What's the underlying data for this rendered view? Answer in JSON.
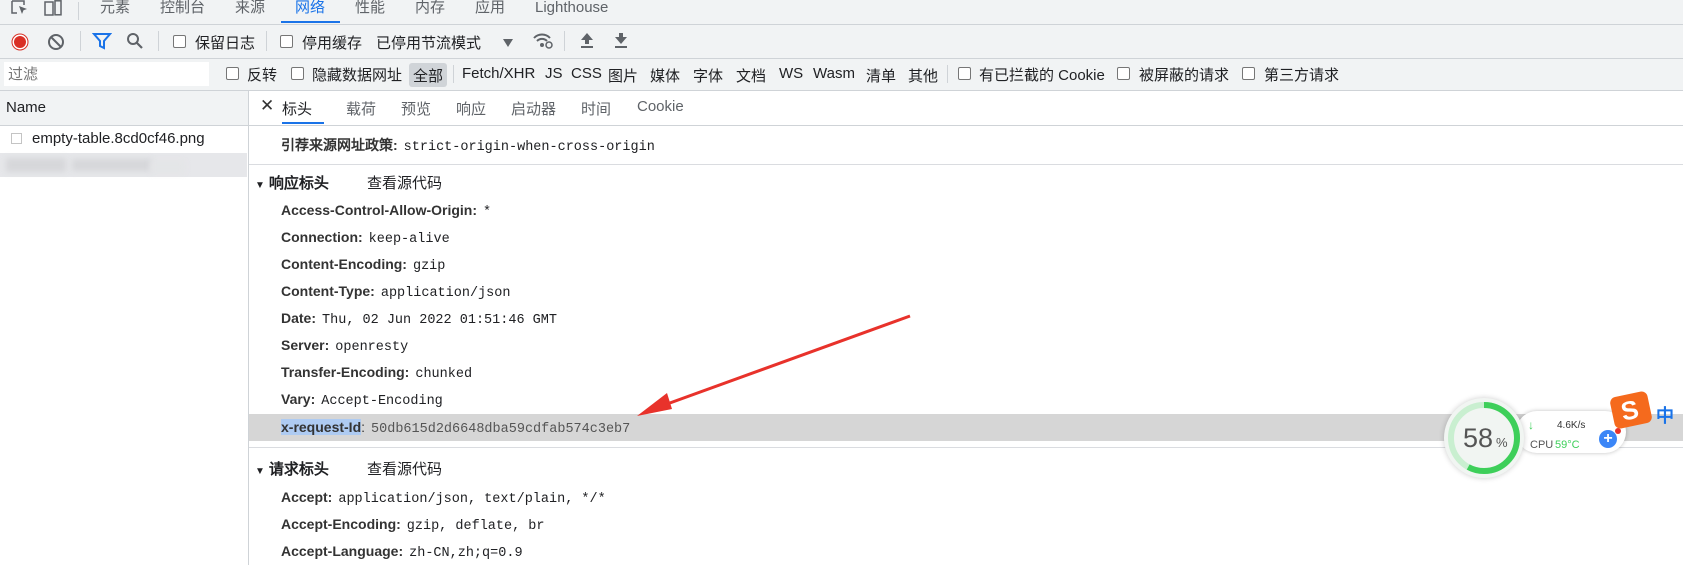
{
  "top_tabs": [
    "元素",
    "控制台",
    "来源",
    "网络",
    "性能",
    "内存",
    "应用",
    "Lighthouse"
  ],
  "active_top_tab": "网络",
  "toolbar": {
    "preserve_log": "保留日志",
    "disable_cache": "停用缓存",
    "throttle": "已停用节流模式"
  },
  "filter": {
    "placeholder": "过滤",
    "invert": "反转",
    "hide_data_urls": "隐藏数据网址",
    "types": [
      "全部",
      "Fetch/XHR",
      "JS",
      "CSS",
      "图片",
      "媒体",
      "字体",
      "文档",
      "WS",
      "Wasm",
      "清单",
      "其他"
    ],
    "blocked_cookies": "有已拦截的 Cookie",
    "blocked_requests": "被屏蔽的请求",
    "third_party": "第三方请求"
  },
  "request_list": {
    "header": "Name",
    "rows": [
      "empty-table.8cd0cf46.png"
    ]
  },
  "detail_tabs": [
    "标头",
    "载荷",
    "预览",
    "响应",
    "启动器",
    "时间",
    "Cookie"
  ],
  "referrer_policy": {
    "name": "引荐来源网址政策:",
    "value": "strict-origin-when-cross-origin"
  },
  "response_headers": {
    "title": "响应标头",
    "view_source": "查看源代码",
    "items": [
      {
        "name": "Access-Control-Allow-Origin:",
        "value": "*"
      },
      {
        "name": "Connection:",
        "value": "keep-alive"
      },
      {
        "name": "Content-Encoding:",
        "value": "gzip"
      },
      {
        "name": "Content-Type:",
        "value": "application/json"
      },
      {
        "name": "Date:",
        "value": "Thu, 02 Jun 2022 01:51:46 GMT"
      },
      {
        "name": "Server:",
        "value": "openresty"
      },
      {
        "name": "Transfer-Encoding:",
        "value": "chunked"
      },
      {
        "name": "Vary:",
        "value": "Accept-Encoding"
      },
      {
        "name": "x-request-Id",
        "value": "50db615d2d6648dba59cdfab574c3eb7"
      }
    ]
  },
  "request_headers": {
    "title": "请求标头",
    "view_source": "查看源代码",
    "items": [
      {
        "name": "Accept:",
        "value": "application/json, text/plain, */*"
      },
      {
        "name": "Accept-Encoding:",
        "value": "gzip, deflate, br"
      },
      {
        "name": "Accept-Language:",
        "value": "zh-CN,zh;q=0.9"
      }
    ]
  },
  "widget": {
    "percent": "58",
    "percent_sign": "%",
    "net_speed": "4.6K/s",
    "cpu_label": "CPU",
    "cpu_temp": "59°C",
    "ime": "中"
  },
  "colors": {
    "accent": "#1a73e8",
    "record": "#d93025",
    "arrow": "#e8322b",
    "gauge": "#3ecf5a"
  }
}
